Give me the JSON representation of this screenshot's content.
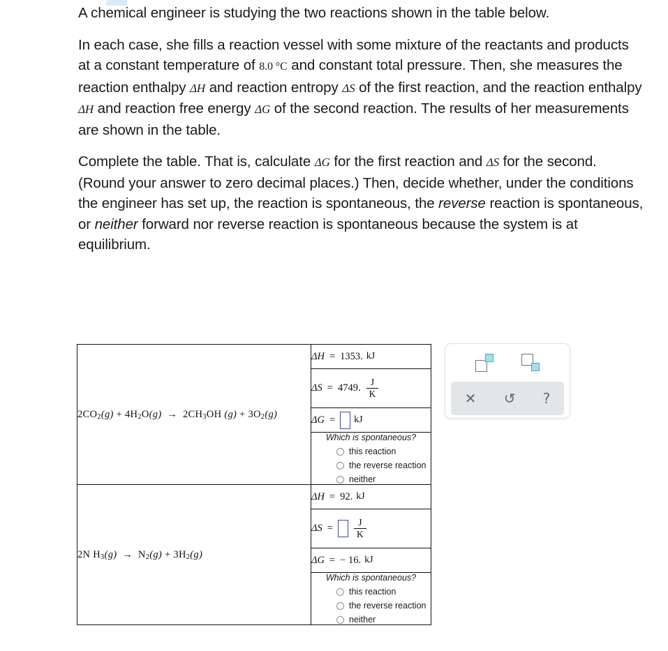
{
  "problem": {
    "paragraph1": "A chemical engineer is studying the two reactions shown in the table below.",
    "paragraph2_a": "In each case, she fills a reaction vessel with some mixture of the reactants and products at a constant temperature of ",
    "temperature": "8.0 °C",
    "paragraph2_b": " and constant total pressure. Then, she measures the reaction enthalpy ",
    "sym_dH": "ΔH",
    "paragraph2_c": " and reaction entropy ",
    "sym_dS": "ΔS",
    "paragraph2_d": " of the first reaction, and the reaction enthalpy ",
    "paragraph2_e": " and reaction free energy ",
    "sym_dG": "ΔG",
    "paragraph2_f": " of the second reaction. The results of her measurements are shown in the table.",
    "paragraph3_a": "Complete the table. That is, calculate ",
    "paragraph3_b": " for the first reaction and ",
    "paragraph3_c": " for the second. (Round your answer to zero decimal places.) Then, decide whether, under the conditions the engineer has set up, the reaction is spontaneous, the ",
    "emph_reverse": "reverse",
    "paragraph3_d": " reaction is spontaneous, or ",
    "emph_neither": "neither",
    "paragraph3_e": " forward nor reverse reaction is spontaneous because the system is at equilibrium."
  },
  "table": {
    "rows": [
      {
        "equation": {
          "parts": [
            {
              "coef": "2",
              "formula": "CO",
              "sub": "2",
              "state": "(g)"
            },
            {
              "op": " + "
            },
            {
              "coef": "4",
              "formula": "H",
              "sub": "2",
              "formula2": "O",
              "state": "(g)"
            },
            {
              "op": " → "
            },
            {
              "coef": "2",
              "formula": "CH",
              "sub": "3",
              "formula2": "OH",
              "state": "(g)"
            },
            {
              "op": " + "
            },
            {
              "coef": "3",
              "formula": "O",
              "sub": "2",
              "state": "(g)"
            }
          ],
          "text": "2CO2(g) + 4H2O(g) → 2CH3OH(g) + 3O2(g)"
        },
        "dH": {
          "label": "ΔH",
          "eq": "=",
          "value": "1353.",
          "unit": "kJ",
          "is_input": false
        },
        "dS": {
          "label": "ΔS",
          "eq": "=",
          "value": "4749.",
          "unit_num": "J",
          "unit_den": "K",
          "is_input": false
        },
        "dG": {
          "label": "ΔG",
          "eq": "=",
          "value": "",
          "unit": "kJ",
          "is_input": true
        },
        "spontaneous": {
          "question": "Which is spontaneous?",
          "options": [
            "this reaction",
            "the reverse reaction",
            "neither"
          ],
          "selected": null
        }
      },
      {
        "equation": {
          "parts": [
            {
              "coef": "2",
              "formula": "N H",
              "sub": "3",
              "state": "(g)"
            },
            {
              "op": " → "
            },
            {
              "coef": "",
              "formula": "N",
              "sub": "2",
              "state": "(g)"
            },
            {
              "op": " + "
            },
            {
              "coef": "3",
              "formula": "H",
              "sub": "2",
              "state": "(g)"
            }
          ],
          "text": "2NH3(g) → N2(g) + 3H2(g)"
        },
        "dH": {
          "label": "ΔH",
          "eq": "=",
          "value": "92.",
          "unit": "kJ",
          "is_input": false
        },
        "dS": {
          "label": "ΔS",
          "eq": "=",
          "value": "",
          "unit_num": "J",
          "unit_den": "K",
          "is_input": true
        },
        "dG": {
          "label": "ΔG",
          "eq": "=",
          "value": "− 16.",
          "unit": "kJ",
          "is_input": false
        },
        "spontaneous": {
          "question": "Which is spontaneous?",
          "options": [
            "this reaction",
            "the reverse reaction",
            "neither"
          ],
          "selected": null
        }
      }
    ]
  },
  "palette": {
    "superscript_label": "superscript",
    "subscript_label": "subscript",
    "clear_icon": "✕",
    "undo_icon": "↺",
    "help_icon": "?"
  },
  "colors": {
    "input_border": "#4042b8",
    "accent_teal": "#a8dcea",
    "accent_teal_border": "#4aa8c0",
    "palette_bar": "#e3e6e8",
    "text": "#1a1a1a"
  }
}
